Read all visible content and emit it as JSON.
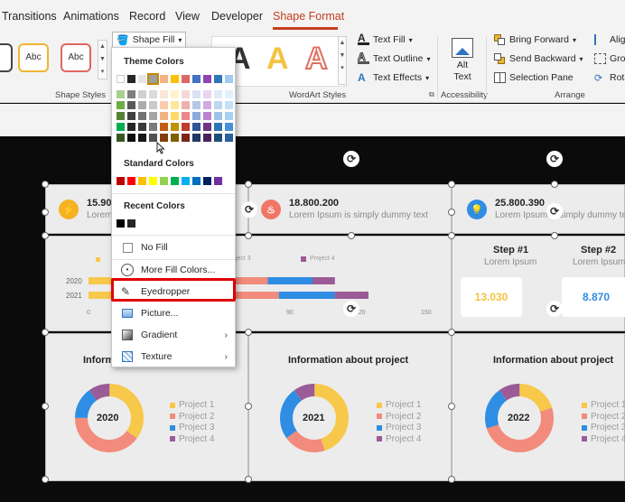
{
  "tabs": [
    {
      "label": "Transitions"
    },
    {
      "label": "Animations"
    },
    {
      "label": "Record"
    },
    {
      "label": "View"
    },
    {
      "label": "Developer"
    },
    {
      "label": "Shape Format",
      "active": true
    }
  ],
  "ribbon": {
    "shape_styles": {
      "label": "Shape Styles",
      "samples": [
        "Abc",
        "Abc"
      ]
    },
    "shape_fill": "Shape Fill",
    "wordart": {
      "label": "WordArt Styles",
      "text_fill": "Text Fill",
      "text_outline": "Text Outline",
      "text_effects": "Text Effects"
    },
    "accessibility": {
      "label": "Accessibility",
      "alt_text_line1": "Alt",
      "alt_text_line2": "Text"
    },
    "arrange": {
      "label": "Arrange",
      "bring_forward": "Bring Forward",
      "send_backward": "Send Backward",
      "selection_pane": "Selection Pane",
      "align": "Alig",
      "group": "Grou",
      "rotate": "Rota"
    }
  },
  "menu": {
    "theme_colors": "Theme Colors",
    "standard_colors": "Standard Colors",
    "recent_colors": "Recent Colors",
    "no_fill": "No Fill",
    "more_fill_colors": "More Fill Colors...",
    "eyedropper": "Eyedropper",
    "picture": "Picture...",
    "gradient": "Gradient",
    "texture": "Texture",
    "theme_top": [
      "#ffffff",
      "#262626",
      "#e7e6e6",
      "#9e9e9e",
      "#f4b183",
      "#ffc000",
      "#e06666",
      "#4472c4",
      "#8e44ad",
      "#2e75b6",
      "#a5c9f0"
    ],
    "theme_cols": [
      [
        "#f2f2f2",
        "#d9d9d9",
        "#bfbfbf",
        "#a6a6a6",
        "#808080"
      ],
      [
        "#7f7f7f",
        "#595959",
        "#404040",
        "#262626",
        "#0d0d0d"
      ],
      [
        "#d0cece",
        "#aeabab",
        "#757171",
        "#3a3838",
        "#171616"
      ],
      [
        "#dbdbdb",
        "#c9c9c9",
        "#a5a5a5",
        "#7b7b7b",
        "#525252"
      ],
      [
        "#fbe5d6",
        "#f8cbad",
        "#f4b183",
        "#c55a11",
        "#833c0b"
      ],
      [
        "#fff2cc",
        "#ffe699",
        "#ffd966",
        "#bf9000",
        "#7f6000"
      ],
      [
        "#f8d7d7",
        "#f1b0b0",
        "#ea8888",
        "#c0392b",
        "#7b241c"
      ],
      [
        "#d9e2f3",
        "#b4c7e7",
        "#8faadc",
        "#2f5597",
        "#1f3864"
      ],
      [
        "#e8d5f0",
        "#d2abe0",
        "#bb82d1",
        "#6c3483",
        "#4a235a"
      ],
      [
        "#deebf7",
        "#bdd7ee",
        "#9dc3e6",
        "#2e75b6",
        "#1f4e79"
      ],
      [
        "#e2f0fb",
        "#c5e0f7",
        "#a8d1f3",
        "#4a90d9",
        "#2c5f9e"
      ]
    ],
    "green_col": [
      "#a9d18e",
      "#70ad47",
      "#548235",
      "#00b050",
      "#385723"
    ],
    "standard": [
      "#c00000",
      "#ff0000",
      "#ffc000",
      "#ffff00",
      "#92d050",
      "#00b050",
      "#00b0f0",
      "#0070c0",
      "#002060",
      "#7030a0"
    ],
    "recent": [
      "#000000",
      "#262626"
    ]
  },
  "slide": {
    "stats": [
      {
        "value": "15.900",
        "sub": "Lorem",
        "color": "#f5b323"
      },
      {
        "value": "18.800.200",
        "sub": "Lorem Ipsum is simply dummy text",
        "color": "#f07766"
      },
      {
        "value": "25.800.390",
        "sub": "Lorem Ipsum is simply dummy te",
        "color": "#2f8de4"
      }
    ],
    "bar_chart": {
      "legend": [
        "Project 3",
        "Project 4"
      ],
      "rows": [
        "2020",
        "2021"
      ],
      "ticks": [
        "0",
        "90",
        "120",
        "150"
      ]
    },
    "steps": [
      {
        "title": "Step #1",
        "sub": "Lorem Ipsum",
        "value": "13.030",
        "color": "#f5c242"
      },
      {
        "title": "Step #2",
        "sub": "Lorem Ipsum",
        "value": "8.870",
        "color": "#2f8de4"
      }
    ],
    "info": [
      {
        "title": "Inform",
        "year": "2020"
      },
      {
        "title": "Information about project",
        "year": "2021"
      },
      {
        "title": "Information about project",
        "year": "2022"
      }
    ],
    "legend": [
      "Project 1",
      "Project 2",
      "Project 3",
      "Project 4"
    ],
    "legend_colors": [
      "#f7c849",
      "#f28b7b",
      "#2f8de4",
      "#9b5b97"
    ]
  },
  "chart_data": [
    {
      "type": "bar",
      "title": "",
      "categories": [
        "2020",
        "2021"
      ],
      "series": [
        {
          "name": "Project 3",
          "values": [
            20,
            25
          ]
        },
        {
          "name": "Project 4",
          "values": [
            10,
            15
          ]
        }
      ],
      "xlim": [
        0,
        150
      ]
    },
    {
      "type": "pie",
      "title": "2020",
      "categories": [
        "Project 1",
        "Project 2",
        "Project 3",
        "Project 4"
      ],
      "values": [
        35,
        40,
        15,
        10
      ]
    },
    {
      "type": "pie",
      "title": "2021",
      "categories": [
        "Project 1",
        "Project 2",
        "Project 3",
        "Project 4"
      ],
      "values": [
        45,
        20,
        25,
        10
      ]
    },
    {
      "type": "pie",
      "title": "2022",
      "categories": [
        "Project 1",
        "Project 2",
        "Project 3",
        "Project 4"
      ],
      "values": [
        20,
        50,
        20,
        10
      ]
    }
  ]
}
